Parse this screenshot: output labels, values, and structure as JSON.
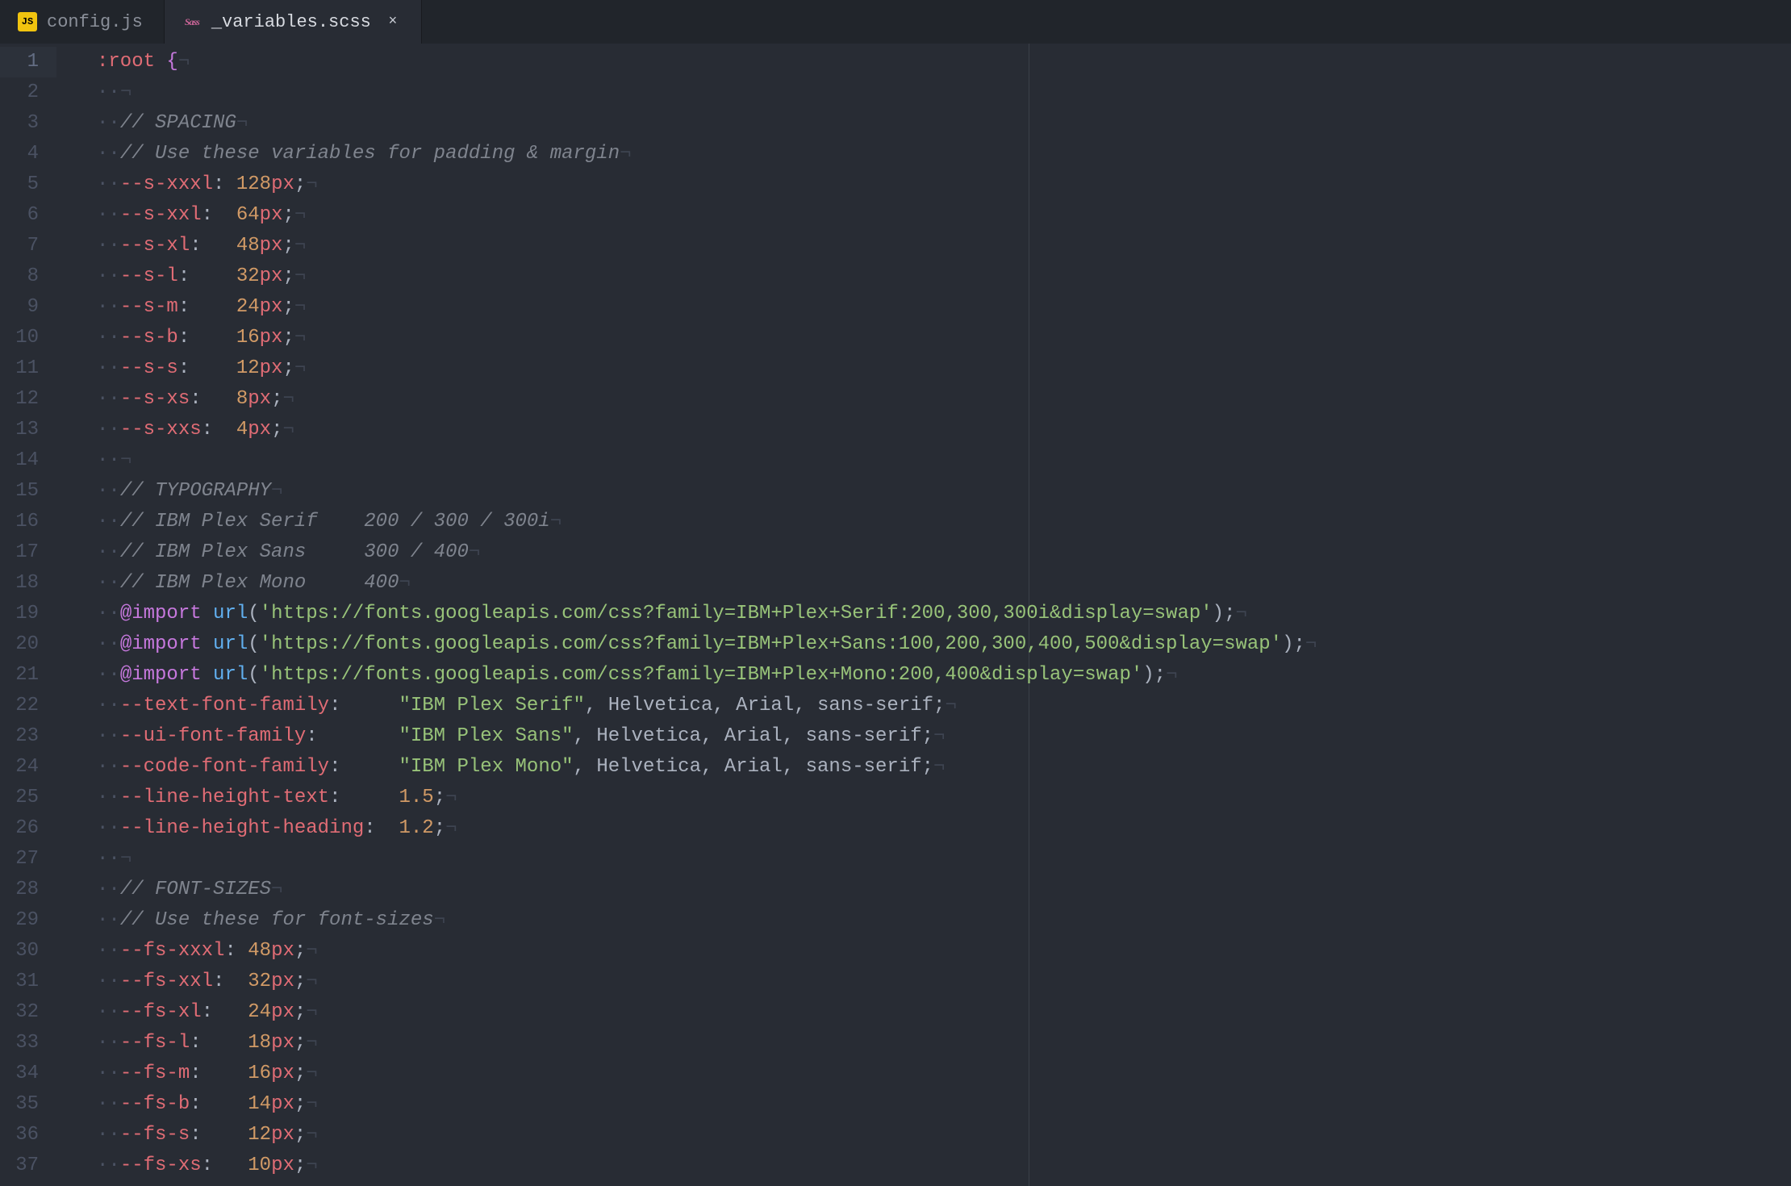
{
  "tabs": [
    {
      "icon": "js",
      "name": "config.js",
      "active": false,
      "closeable": false
    },
    {
      "icon": "sass",
      "name": "_variables.scss",
      "active": true,
      "closeable": true
    }
  ],
  "close_glyph": "×",
  "editor": {
    "ruler_column": 80,
    "current_line": 1,
    "lines": [
      {
        "n": 1,
        "indent": 0,
        "segments": [
          {
            "t": ":root",
            "c": "tok-sel"
          },
          {
            "t": " ",
            "c": "tok-punct"
          },
          {
            "t": "{",
            "c": "tok-brace"
          }
        ]
      },
      {
        "n": 2,
        "indent": 1,
        "segments": []
      },
      {
        "n": 3,
        "indent": 1,
        "segments": [
          {
            "t": "// SPACING",
            "c": "tok-comment"
          }
        ]
      },
      {
        "n": 4,
        "indent": 1,
        "segments": [
          {
            "t": "// Use these variables for padding & margin",
            "c": "tok-comment"
          }
        ]
      },
      {
        "n": 5,
        "indent": 1,
        "segments": [
          {
            "t": "--s-xxxl",
            "c": "tok-var"
          },
          {
            "t": ": ",
            "c": "tok-punct"
          },
          {
            "t": "128",
            "c": "tok-num"
          },
          {
            "t": "px",
            "c": "tok-unit"
          },
          {
            "t": ";",
            "c": "tok-punct"
          }
        ]
      },
      {
        "n": 6,
        "indent": 1,
        "segments": [
          {
            "t": "--s-xxl",
            "c": "tok-var"
          },
          {
            "t": ":  ",
            "c": "tok-punct"
          },
          {
            "t": "64",
            "c": "tok-num"
          },
          {
            "t": "px",
            "c": "tok-unit"
          },
          {
            "t": ";",
            "c": "tok-punct"
          }
        ]
      },
      {
        "n": 7,
        "indent": 1,
        "segments": [
          {
            "t": "--s-xl",
            "c": "tok-var"
          },
          {
            "t": ":   ",
            "c": "tok-punct"
          },
          {
            "t": "48",
            "c": "tok-num"
          },
          {
            "t": "px",
            "c": "tok-unit"
          },
          {
            "t": ";",
            "c": "tok-punct"
          }
        ]
      },
      {
        "n": 8,
        "indent": 1,
        "segments": [
          {
            "t": "--s-l",
            "c": "tok-var"
          },
          {
            "t": ":    ",
            "c": "tok-punct"
          },
          {
            "t": "32",
            "c": "tok-num"
          },
          {
            "t": "px",
            "c": "tok-unit"
          },
          {
            "t": ";",
            "c": "tok-punct"
          }
        ]
      },
      {
        "n": 9,
        "indent": 1,
        "segments": [
          {
            "t": "--s-m",
            "c": "tok-var"
          },
          {
            "t": ":    ",
            "c": "tok-punct"
          },
          {
            "t": "24",
            "c": "tok-num"
          },
          {
            "t": "px",
            "c": "tok-unit"
          },
          {
            "t": ";",
            "c": "tok-punct"
          }
        ]
      },
      {
        "n": 10,
        "indent": 1,
        "segments": [
          {
            "t": "--s-b",
            "c": "tok-var"
          },
          {
            "t": ":    ",
            "c": "tok-punct"
          },
          {
            "t": "16",
            "c": "tok-num"
          },
          {
            "t": "px",
            "c": "tok-unit"
          },
          {
            "t": ";",
            "c": "tok-punct"
          }
        ]
      },
      {
        "n": 11,
        "indent": 1,
        "segments": [
          {
            "t": "--s-s",
            "c": "tok-var"
          },
          {
            "t": ":    ",
            "c": "tok-punct"
          },
          {
            "t": "12",
            "c": "tok-num"
          },
          {
            "t": "px",
            "c": "tok-unit"
          },
          {
            "t": ";",
            "c": "tok-punct"
          }
        ]
      },
      {
        "n": 12,
        "indent": 1,
        "segments": [
          {
            "t": "--s-xs",
            "c": "tok-var"
          },
          {
            "t": ":   ",
            "c": "tok-punct"
          },
          {
            "t": "8",
            "c": "tok-num"
          },
          {
            "t": "px",
            "c": "tok-unit"
          },
          {
            "t": ";",
            "c": "tok-punct"
          }
        ]
      },
      {
        "n": 13,
        "indent": 1,
        "segments": [
          {
            "t": "--s-xxs",
            "c": "tok-var"
          },
          {
            "t": ":  ",
            "c": "tok-punct"
          },
          {
            "t": "4",
            "c": "tok-num"
          },
          {
            "t": "px",
            "c": "tok-unit"
          },
          {
            "t": ";",
            "c": "tok-punct"
          }
        ]
      },
      {
        "n": 14,
        "indent": 1,
        "segments": []
      },
      {
        "n": 15,
        "indent": 1,
        "segments": [
          {
            "t": "// TYPOGRAPHY",
            "c": "tok-comment"
          }
        ]
      },
      {
        "n": 16,
        "indent": 1,
        "segments": [
          {
            "t": "// IBM Plex Serif    200 / 300 / 300i",
            "c": "tok-comment"
          }
        ]
      },
      {
        "n": 17,
        "indent": 1,
        "segments": [
          {
            "t": "// IBM Plex Sans     300 / 400",
            "c": "tok-comment"
          }
        ]
      },
      {
        "n": 18,
        "indent": 1,
        "segments": [
          {
            "t": "// IBM Plex Mono     400",
            "c": "tok-comment"
          }
        ]
      },
      {
        "n": 19,
        "indent": 1,
        "segments": [
          {
            "t": "@import",
            "c": "tok-kw"
          },
          {
            "t": " ",
            "c": "tok-punct"
          },
          {
            "t": "url",
            "c": "tok-fn"
          },
          {
            "t": "(",
            "c": "tok-punct"
          },
          {
            "t": "'https://fonts.googleapis.com/css?family=IBM+Plex+Serif:200,300,300i&display=swap'",
            "c": "tok-str"
          },
          {
            "t": ");",
            "c": "tok-punct"
          }
        ]
      },
      {
        "n": 20,
        "indent": 1,
        "segments": [
          {
            "t": "@import",
            "c": "tok-kw"
          },
          {
            "t": " ",
            "c": "tok-punct"
          },
          {
            "t": "url",
            "c": "tok-fn"
          },
          {
            "t": "(",
            "c": "tok-punct"
          },
          {
            "t": "'https://fonts.googleapis.com/css?family=IBM+Plex+Sans:100,200,300,400,500&display=swap'",
            "c": "tok-str"
          },
          {
            "t": ");",
            "c": "tok-punct"
          }
        ]
      },
      {
        "n": 21,
        "indent": 1,
        "segments": [
          {
            "t": "@import",
            "c": "tok-kw"
          },
          {
            "t": " ",
            "c": "tok-punct"
          },
          {
            "t": "url",
            "c": "tok-fn"
          },
          {
            "t": "(",
            "c": "tok-punct"
          },
          {
            "t": "'https://fonts.googleapis.com/css?family=IBM+Plex+Mono:200,400&display=swap'",
            "c": "tok-str"
          },
          {
            "t": ");",
            "c": "tok-punct"
          }
        ]
      },
      {
        "n": 22,
        "indent": 1,
        "segments": [
          {
            "t": "--text-font-family",
            "c": "tok-var"
          },
          {
            "t": ":     ",
            "c": "tok-punct"
          },
          {
            "t": "\"IBM Plex Serif\"",
            "c": "tok-str"
          },
          {
            "t": ", ",
            "c": "tok-punct"
          },
          {
            "t": "Helvetica",
            "c": "tok-ident"
          },
          {
            "t": ", ",
            "c": "tok-punct"
          },
          {
            "t": "Arial",
            "c": "tok-ident"
          },
          {
            "t": ", ",
            "c": "tok-punct"
          },
          {
            "t": "sans-serif",
            "c": "tok-ident"
          },
          {
            "t": ";",
            "c": "tok-punct"
          }
        ]
      },
      {
        "n": 23,
        "indent": 1,
        "segments": [
          {
            "t": "--ui-font-family",
            "c": "tok-var"
          },
          {
            "t": ":       ",
            "c": "tok-punct"
          },
          {
            "t": "\"IBM Plex Sans\"",
            "c": "tok-str"
          },
          {
            "t": ", ",
            "c": "tok-punct"
          },
          {
            "t": "Helvetica",
            "c": "tok-ident"
          },
          {
            "t": ", ",
            "c": "tok-punct"
          },
          {
            "t": "Arial",
            "c": "tok-ident"
          },
          {
            "t": ", ",
            "c": "tok-punct"
          },
          {
            "t": "sans-serif",
            "c": "tok-ident"
          },
          {
            "t": ";",
            "c": "tok-punct"
          }
        ]
      },
      {
        "n": 24,
        "indent": 1,
        "segments": [
          {
            "t": "--code-font-family",
            "c": "tok-var"
          },
          {
            "t": ":     ",
            "c": "tok-punct"
          },
          {
            "t": "\"IBM Plex Mono\"",
            "c": "tok-str"
          },
          {
            "t": ", ",
            "c": "tok-punct"
          },
          {
            "t": "Helvetica",
            "c": "tok-ident"
          },
          {
            "t": ", ",
            "c": "tok-punct"
          },
          {
            "t": "Arial",
            "c": "tok-ident"
          },
          {
            "t": ", ",
            "c": "tok-punct"
          },
          {
            "t": "sans-serif",
            "c": "tok-ident"
          },
          {
            "t": ";",
            "c": "tok-punct"
          }
        ]
      },
      {
        "n": 25,
        "indent": 1,
        "segments": [
          {
            "t": "--line-height-text",
            "c": "tok-var"
          },
          {
            "t": ":     ",
            "c": "tok-punct"
          },
          {
            "t": "1.5",
            "c": "tok-num"
          },
          {
            "t": ";",
            "c": "tok-punct"
          }
        ]
      },
      {
        "n": 26,
        "indent": 1,
        "segments": [
          {
            "t": "--line-height-heading",
            "c": "tok-var"
          },
          {
            "t": ":  ",
            "c": "tok-punct"
          },
          {
            "t": "1.2",
            "c": "tok-num"
          },
          {
            "t": ";",
            "c": "tok-punct"
          }
        ]
      },
      {
        "n": 27,
        "indent": 1,
        "segments": []
      },
      {
        "n": 28,
        "indent": 1,
        "segments": [
          {
            "t": "// FONT-SIZES",
            "c": "tok-comment"
          }
        ]
      },
      {
        "n": 29,
        "indent": 1,
        "segments": [
          {
            "t": "// Use these for font-sizes",
            "c": "tok-comment"
          }
        ]
      },
      {
        "n": 30,
        "indent": 1,
        "segments": [
          {
            "t": "--fs-xxxl",
            "c": "tok-var"
          },
          {
            "t": ": ",
            "c": "tok-punct"
          },
          {
            "t": "48",
            "c": "tok-num"
          },
          {
            "t": "px",
            "c": "tok-unit"
          },
          {
            "t": ";",
            "c": "tok-punct"
          }
        ]
      },
      {
        "n": 31,
        "indent": 1,
        "segments": [
          {
            "t": "--fs-xxl",
            "c": "tok-var"
          },
          {
            "t": ":  ",
            "c": "tok-punct"
          },
          {
            "t": "32",
            "c": "tok-num"
          },
          {
            "t": "px",
            "c": "tok-unit"
          },
          {
            "t": ";",
            "c": "tok-punct"
          }
        ]
      },
      {
        "n": 32,
        "indent": 1,
        "segments": [
          {
            "t": "--fs-xl",
            "c": "tok-var"
          },
          {
            "t": ":   ",
            "c": "tok-punct"
          },
          {
            "t": "24",
            "c": "tok-num"
          },
          {
            "t": "px",
            "c": "tok-unit"
          },
          {
            "t": ";",
            "c": "tok-punct"
          }
        ]
      },
      {
        "n": 33,
        "indent": 1,
        "segments": [
          {
            "t": "--fs-l",
            "c": "tok-var"
          },
          {
            "t": ":    ",
            "c": "tok-punct"
          },
          {
            "t": "18",
            "c": "tok-num"
          },
          {
            "t": "px",
            "c": "tok-unit"
          },
          {
            "t": ";",
            "c": "tok-punct"
          }
        ]
      },
      {
        "n": 34,
        "indent": 1,
        "segments": [
          {
            "t": "--fs-m",
            "c": "tok-var"
          },
          {
            "t": ":    ",
            "c": "tok-punct"
          },
          {
            "t": "16",
            "c": "tok-num"
          },
          {
            "t": "px",
            "c": "tok-unit"
          },
          {
            "t": ";",
            "c": "tok-punct"
          }
        ]
      },
      {
        "n": 35,
        "indent": 1,
        "segments": [
          {
            "t": "--fs-b",
            "c": "tok-var"
          },
          {
            "t": ":    ",
            "c": "tok-punct"
          },
          {
            "t": "14",
            "c": "tok-num"
          },
          {
            "t": "px",
            "c": "tok-unit"
          },
          {
            "t": ";",
            "c": "tok-punct"
          }
        ]
      },
      {
        "n": 36,
        "indent": 1,
        "segments": [
          {
            "t": "--fs-s",
            "c": "tok-var"
          },
          {
            "t": ":    ",
            "c": "tok-punct"
          },
          {
            "t": "12",
            "c": "tok-num"
          },
          {
            "t": "px",
            "c": "tok-unit"
          },
          {
            "t": ";",
            "c": "tok-punct"
          }
        ]
      },
      {
        "n": 37,
        "indent": 1,
        "segments": [
          {
            "t": "--fs-xs",
            "c": "tok-var"
          },
          {
            "t": ":   ",
            "c": "tok-punct"
          },
          {
            "t": "10",
            "c": "tok-num"
          },
          {
            "t": "px",
            "c": "tok-unit"
          },
          {
            "t": ";",
            "c": "tok-punct"
          }
        ]
      }
    ]
  }
}
